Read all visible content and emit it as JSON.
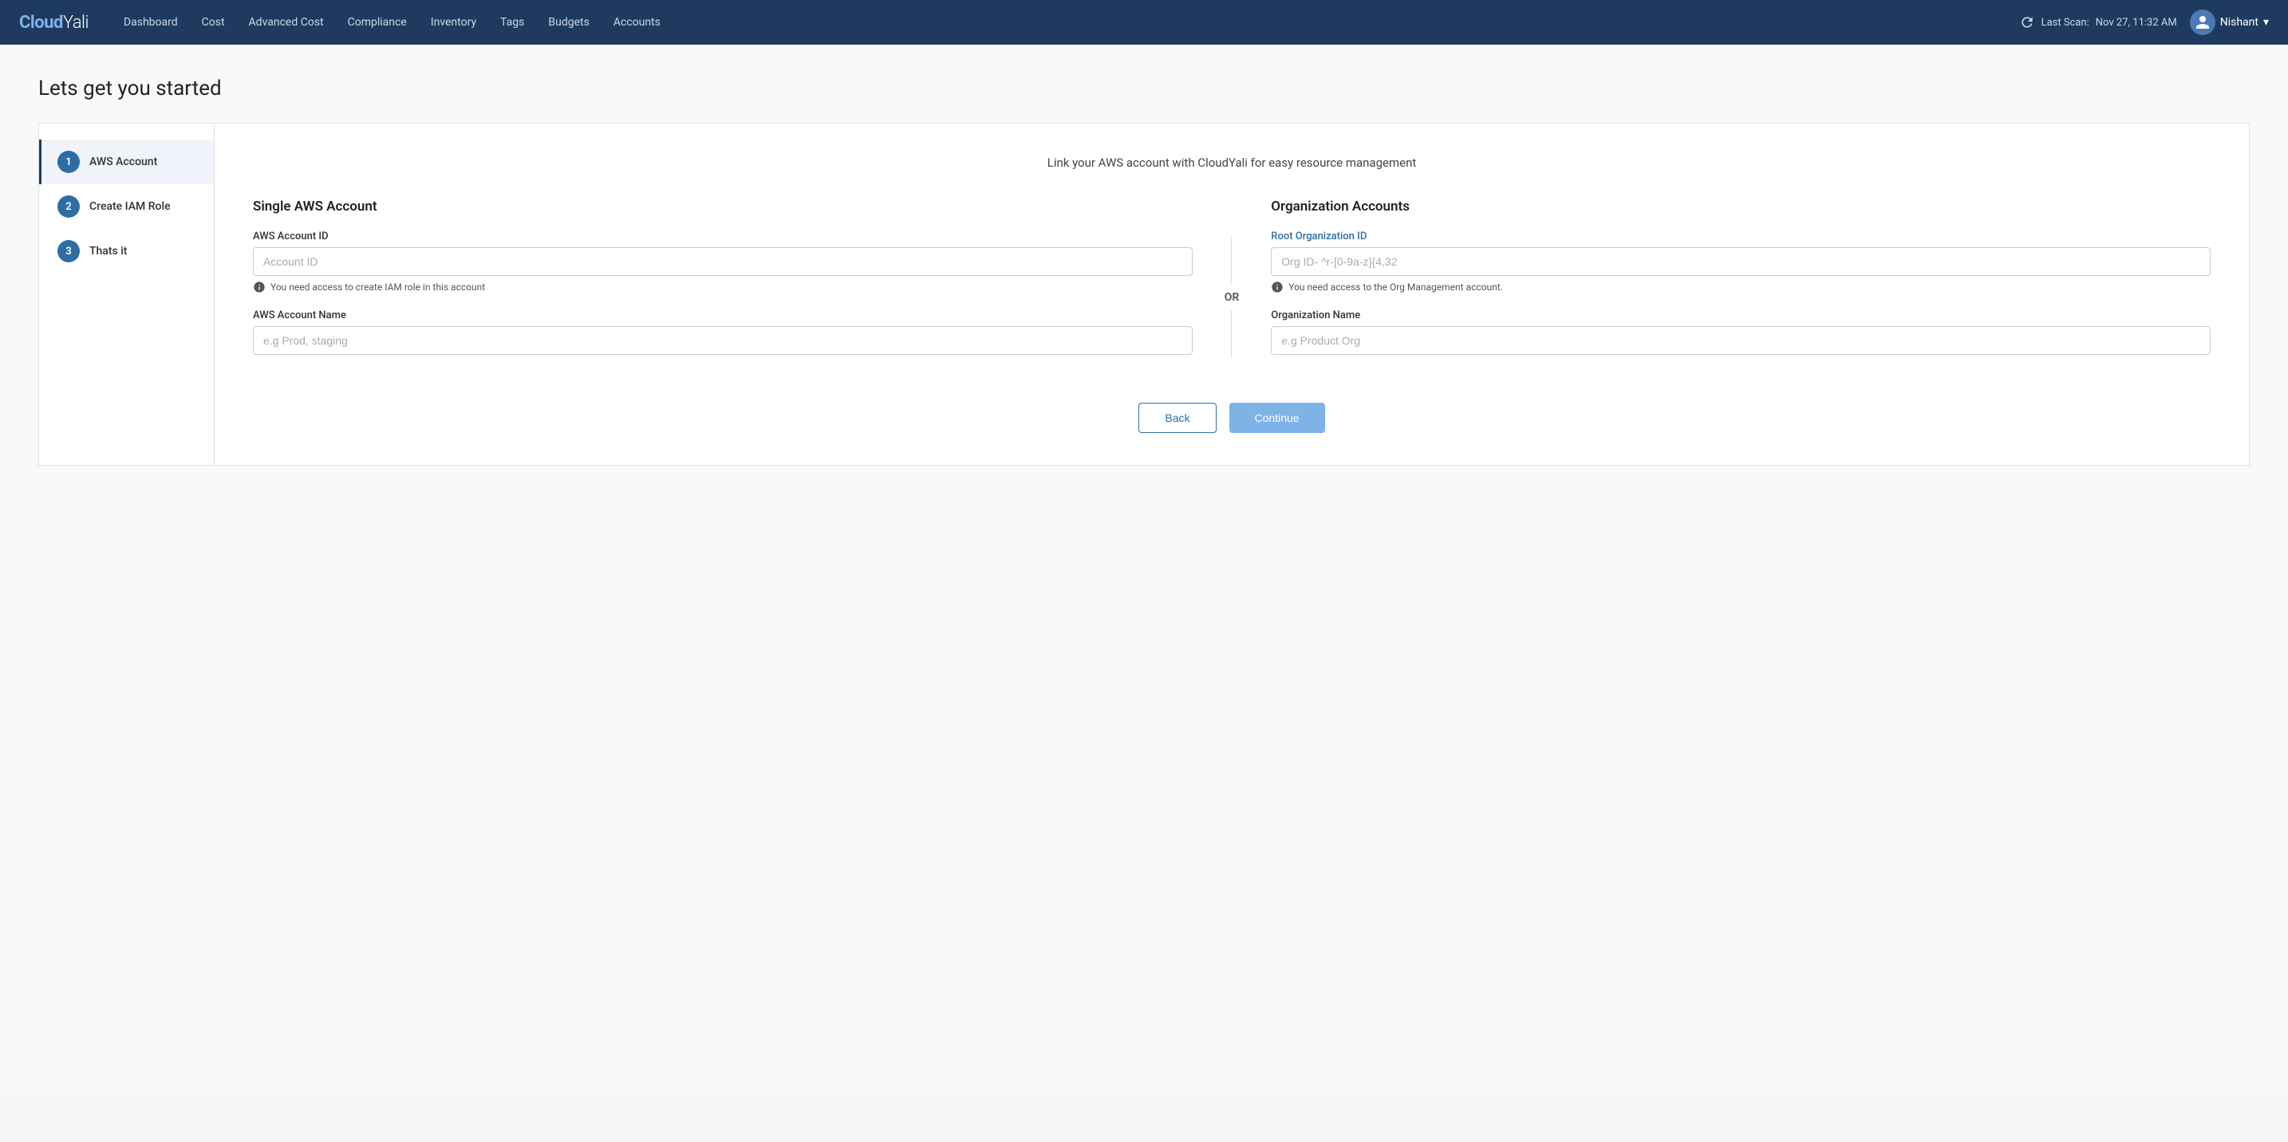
{
  "brand": {
    "cloud": "Cloud",
    "yali": "Yali"
  },
  "nav": {
    "links": [
      {
        "id": "dashboard",
        "label": "Dashboard"
      },
      {
        "id": "cost",
        "label": "Cost"
      },
      {
        "id": "advanced-cost",
        "label": "Advanced Cost"
      },
      {
        "id": "compliance",
        "label": "Compliance"
      },
      {
        "id": "inventory",
        "label": "Inventory"
      },
      {
        "id": "tags",
        "label": "Tags"
      },
      {
        "id": "budgets",
        "label": "Budgets"
      },
      {
        "id": "accounts",
        "label": "Accounts"
      }
    ],
    "last_scan_prefix": "Last Scan:",
    "last_scan_time": "Nov 27, 11:32 AM",
    "user_name": "Nishant",
    "user_chevron": "▾"
  },
  "page": {
    "title": "Lets get you started"
  },
  "steps": [
    {
      "number": "1",
      "label": "AWS Account",
      "active": true
    },
    {
      "number": "2",
      "label": "Create IAM Role",
      "active": false
    },
    {
      "number": "3",
      "label": "Thats it",
      "active": false
    }
  ],
  "panel": {
    "subtitle": "Link your AWS account with CloudYali for easy resource management"
  },
  "single_aws": {
    "heading": "Single AWS Account",
    "account_id_label": "AWS Account ID",
    "account_id_placeholder": "Account ID",
    "account_id_hint": "You need access to create IAM role in this account",
    "account_name_label": "AWS Account Name",
    "account_name_placeholder": "e.g Prod, staging"
  },
  "or_label": "OR",
  "org_accounts": {
    "heading": "Organization Accounts",
    "root_org_label": "Root Organization ID",
    "root_org_placeholder": "Org ID- ^r-[0-9a-z]{4,32",
    "root_org_hint": "You need access to the Org Management account.",
    "org_name_label": "Organization Name",
    "org_name_placeholder": "e.g Product Org"
  },
  "actions": {
    "back_label": "Back",
    "continue_label": "Continue"
  }
}
